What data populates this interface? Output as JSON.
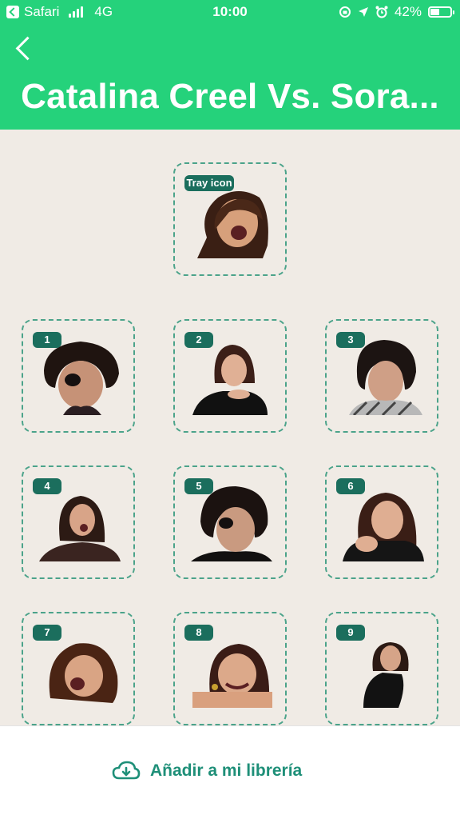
{
  "status_bar": {
    "back_app": "Safari",
    "network": "4G",
    "time": "10:00",
    "battery": "42%"
  },
  "header": {
    "title": "Catalina Creel Vs. Sora..."
  },
  "tray": {
    "label": "Tray icon"
  },
  "stickers": [
    {
      "number": "1"
    },
    {
      "number": "2"
    },
    {
      "number": "3"
    },
    {
      "number": "4"
    },
    {
      "number": "5"
    },
    {
      "number": "6"
    },
    {
      "number": "7"
    },
    {
      "number": "8"
    },
    {
      "number": "9"
    }
  ],
  "footer": {
    "add_label": "Añadir a mi librería"
  },
  "colors": {
    "header_green": "#25d27b",
    "badge_teal": "#1b6e5d",
    "dashed_border": "#4ba38a",
    "background": "#f0ebe5",
    "add_text": "#1e8f78"
  }
}
